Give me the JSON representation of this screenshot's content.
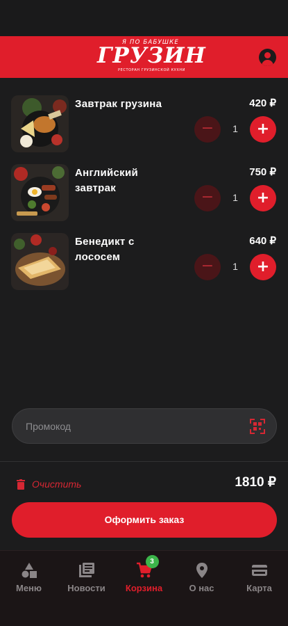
{
  "header": {
    "logo_small": "Я ПО БАБУШКЕ",
    "logo_main": "ГРУЗИН",
    "logo_sub": "РЕСТОРАН ГРУЗИНСКОЙ КУХНИ",
    "brand_color": "#e01e2b"
  },
  "cart": {
    "items": [
      {
        "name": "Завтрак грузина",
        "price": "420 ₽",
        "quantity": "1",
        "minus": "−",
        "plus": "+"
      },
      {
        "name": "Английский завтрак",
        "price": "750 ₽",
        "quantity": "1",
        "minus": "−",
        "plus": "+"
      },
      {
        "name": "Бенедикт с лососем",
        "price": "640 ₽",
        "quantity": "1",
        "minus": "−",
        "plus": "+"
      }
    ]
  },
  "promo": {
    "placeholder": "Промокод",
    "value": ""
  },
  "summary": {
    "clear_label": "Очистить",
    "total": "1810 ₽",
    "checkout_label": "Оформить заказ"
  },
  "tabbar": {
    "items": [
      {
        "label": "Меню",
        "icon": "shapes-icon"
      },
      {
        "label": "Новости",
        "icon": "news-icon"
      },
      {
        "label": "Корзина",
        "icon": "cart-icon",
        "badge": "3",
        "active": true
      },
      {
        "label": "О нас",
        "icon": "location-pin-icon"
      },
      {
        "label": "Карта",
        "icon": "card-icon"
      }
    ]
  }
}
